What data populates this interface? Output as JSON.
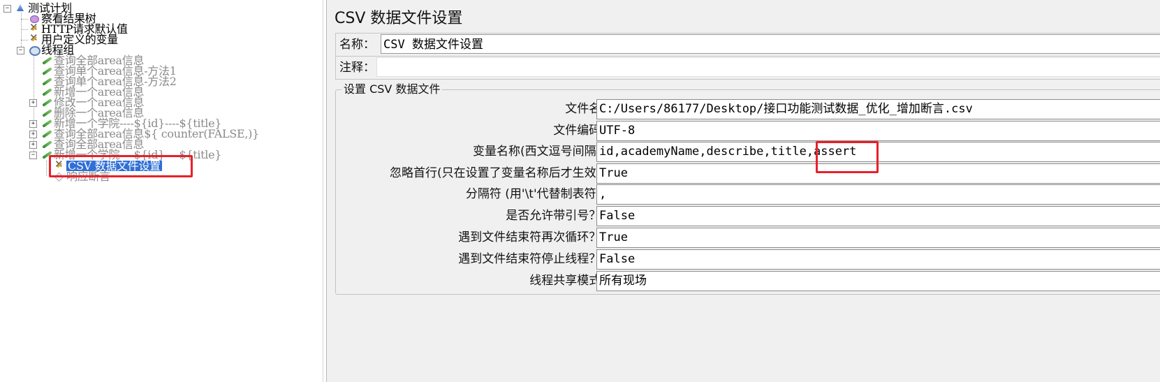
{
  "tree": {
    "root": "测试计划",
    "items": [
      {
        "label": "察看结果树"
      },
      {
        "label": "HTTP请求默认值"
      },
      {
        "label": "用户定义的变量"
      },
      {
        "label": "线程组"
      },
      {
        "label": "查询全部area信息"
      },
      {
        "label": "查询单个area信息-方法1"
      },
      {
        "label": "查询单个area信息-方法2"
      },
      {
        "label": "新增一个area信息"
      },
      {
        "label": "修改一个area信息"
      },
      {
        "label": "删除一个area信息"
      },
      {
        "label": "新增一个学院----${id}----${title}"
      },
      {
        "label": "查询全部area信息${  counter(FALSE,)}"
      },
      {
        "label": "查询全部area信息"
      },
      {
        "label": "新增一个学院----${id}----${title}"
      },
      {
        "label": "CSV 数据文件设置"
      },
      {
        "label": "响应断言"
      }
    ],
    "toggle_collapsed": "+",
    "toggle_expanded": "−"
  },
  "panel": {
    "title": "CSV 数据文件设置",
    "name_label": "名称：",
    "name_value": "CSV 数据文件设置",
    "comment_label": "注释：",
    "comment_value": "",
    "group_title": "设置 CSV 数据文件",
    "properties": [
      {
        "label": "文件名:",
        "value": "C:/Users/86177/Desktop/接口功能测试数据_优化_增加断言.csv"
      },
      {
        "label": "文件编码:",
        "value": "UTF-8"
      },
      {
        "label": "变量名称(西文逗号间隔):",
        "value": "id,academyName,describe,title,assert"
      },
      {
        "label": "忽略首行(只在设置了变量名称后才生效):",
        "value": "True"
      },
      {
        "label": "分隔符 (用'\\t'代替制表符):",
        "value": ","
      },
      {
        "label": "是否允许带引号？:",
        "value": "False"
      },
      {
        "label": "遇到文件结束符再次循环？:",
        "value": "True"
      },
      {
        "label": "遇到文件结束符停止线程？:",
        "value": "False"
      },
      {
        "label": "线程共享模式:",
        "value": "所有现场"
      }
    ]
  },
  "colors": {
    "highlight_box": "#e8202a",
    "selection": "#2f6fd6",
    "panel_bg": "#f0f0f0"
  }
}
